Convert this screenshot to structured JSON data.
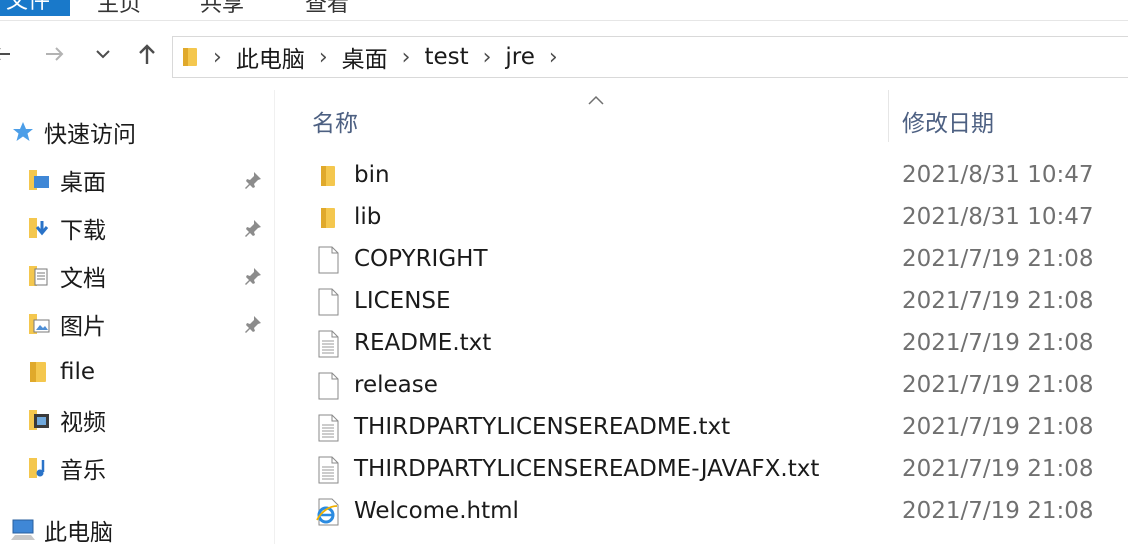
{
  "ribbon": {
    "tabs": [
      "文件",
      "主页",
      "共享",
      "查看"
    ]
  },
  "address": {
    "crumbs": [
      "此电脑",
      "桌面",
      "test",
      "jre"
    ]
  },
  "nav_pane": {
    "quick_access": "快速访问",
    "items": [
      {
        "label": "桌面",
        "icon": "desktop-icon",
        "pinned": true
      },
      {
        "label": "下载",
        "icon": "download-icon",
        "pinned": true
      },
      {
        "label": "文档",
        "icon": "document-icon",
        "pinned": true
      },
      {
        "label": "图片",
        "icon": "picture-icon",
        "pinned": true
      },
      {
        "label": "file",
        "icon": "folder-icon",
        "pinned": false
      },
      {
        "label": "视频",
        "icon": "video-icon",
        "pinned": false
      },
      {
        "label": "音乐",
        "icon": "music-icon",
        "pinned": false
      }
    ],
    "this_pc": "此电脑"
  },
  "columns": {
    "name": "名称",
    "date": "修改日期"
  },
  "files": [
    {
      "name": "bin",
      "date": "2021/8/31 10:47",
      "icon": "folder-icon"
    },
    {
      "name": "lib",
      "date": "2021/8/31 10:47",
      "icon": "folder-icon"
    },
    {
      "name": "COPYRIGHT",
      "date": "2021/7/19 21:08",
      "icon": "file-icon"
    },
    {
      "name": "LICENSE",
      "date": "2021/7/19 21:08",
      "icon": "file-icon"
    },
    {
      "name": "README.txt",
      "date": "2021/7/19 21:08",
      "icon": "text-file-icon"
    },
    {
      "name": "release",
      "date": "2021/7/19 21:08",
      "icon": "file-icon"
    },
    {
      "name": "THIRDPARTYLICENSEREADME.txt",
      "date": "2021/7/19 21:08",
      "icon": "text-file-icon"
    },
    {
      "name": "THIRDPARTYLICENSEREADME-JAVAFX.txt",
      "date": "2021/7/19 21:08",
      "icon": "text-file-icon"
    },
    {
      "name": "Welcome.html",
      "date": "2021/7/19 21:08",
      "icon": "ie-html-icon"
    }
  ],
  "colors": {
    "accent": "#1979ca",
    "folder": "#f4c74e",
    "header_text": "#4d6082",
    "date_text": "#707070"
  }
}
